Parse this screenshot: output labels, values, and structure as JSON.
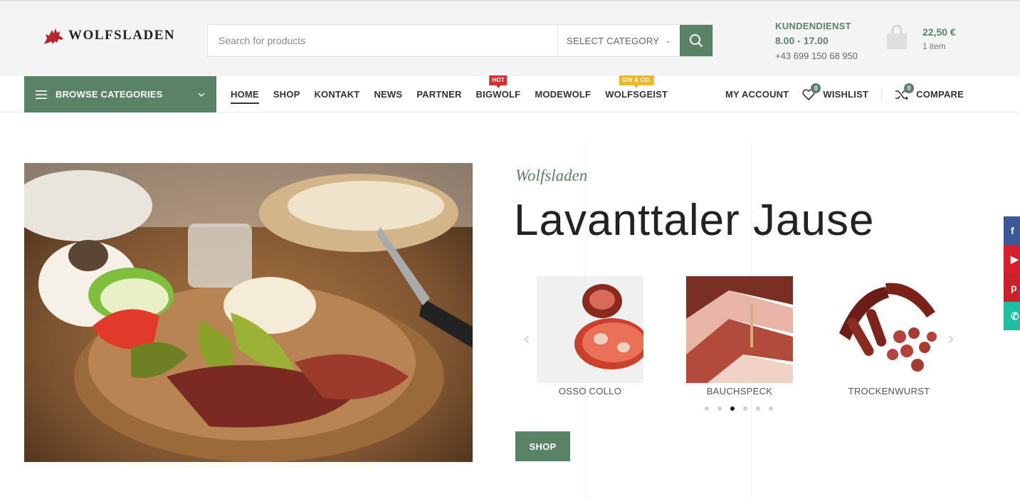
{
  "brand": {
    "name": "WOLFSLADEN"
  },
  "search": {
    "placeholder": "Search for products",
    "category_label": "SELECT CATEGORY"
  },
  "service": {
    "title": "KUNDENDIENST",
    "hours": "8.00 - 17.00",
    "phone": "+43 699 150 68 950"
  },
  "cart": {
    "total": "22,50 €",
    "items": "1 item"
  },
  "nav": {
    "browse_label": "BROWSE CATEGORIES",
    "items": [
      {
        "label": "HOME",
        "active": true
      },
      {
        "label": "SHOP"
      },
      {
        "label": "KONTAKT"
      },
      {
        "label": "NEWS"
      },
      {
        "label": "PARTNER"
      },
      {
        "label": "BIGWOLF",
        "badge": "HOT"
      },
      {
        "label": "MODEWOLF"
      },
      {
        "label": "WOLFSGEIST",
        "badge": "GIN & CO."
      }
    ],
    "account_label": "MY ACCOUNT",
    "wishlist_label": "WISHLIST",
    "wishlist_count": "0",
    "compare_label": "COMPARE",
    "compare_count": "0"
  },
  "hero": {
    "subtitle": "Wolfsladen",
    "title": "Lavanttaler Jause",
    "shop_label": "SHOP",
    "products": [
      {
        "name": "OSSO COLLO"
      },
      {
        "name": "BAUCHSPECK"
      },
      {
        "name": "TROCKENWURST"
      }
    ],
    "dots_total": 6,
    "dots_active": 3
  },
  "social": [
    {
      "name": "facebook-icon",
      "glyph": "f",
      "color": "#3b5998"
    },
    {
      "name": "youtube-icon",
      "glyph": "▶",
      "color": "#d81e2b"
    },
    {
      "name": "pinterest-icon",
      "glyph": "p",
      "color": "#cb2027"
    },
    {
      "name": "whatsapp-icon",
      "glyph": "✆",
      "color": "#1ebea5"
    }
  ],
  "colors": {
    "accent": "#5a8267",
    "hot": "#d32f2f",
    "gin": "#f2b62d"
  }
}
